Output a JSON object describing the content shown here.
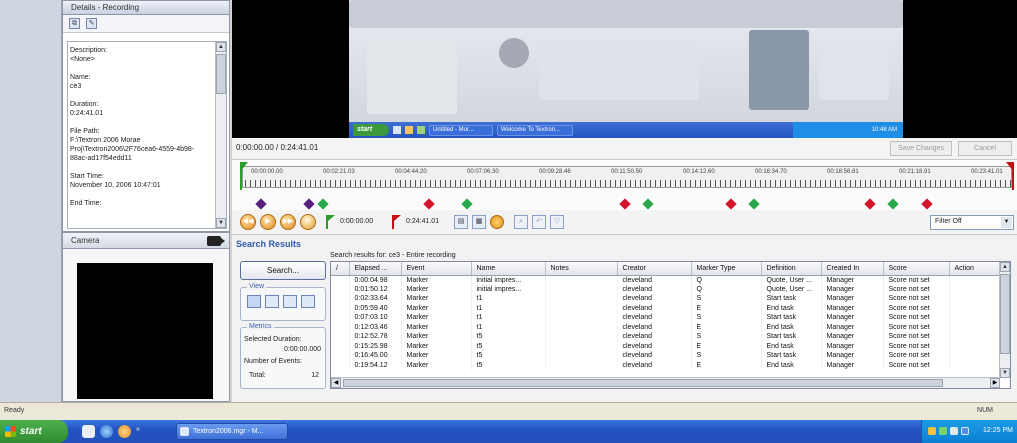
{
  "details": {
    "title": "Details - Recording",
    "content": "Description:\n<None>\n\nName:\nce3\n\nDuration:\n0:24:41.01\n\nFile Path:\nF:\\Textron 2006 Morae Proj\\Textron2006\\2F76cea6-4559-4b98-88ac-ad17f54edd11\n\nStart Time:\nNovember 10, 2006 10:47:01\n\nEnd Time:"
  },
  "camera": {
    "title": "Camera"
  },
  "video": {
    "start_label": "start",
    "taskbar_items": [
      "Untitled - Mor...",
      "Welcome To Textron..."
    ],
    "tray_time": "10:48 AM"
  },
  "timeline": {
    "time_display": "0:00:00.00 / 0:24:41.01",
    "save_changes": "Save Changes",
    "cancel": "Cancel",
    "tick_labels": [
      "00:00:00.00",
      "00:02:21.03",
      "00:04:44.20",
      "00:07:06.30",
      "00:09:28.46",
      "00:11:50.50",
      "00:14:12.60",
      "00:16:34.70",
      "00:18:56.81",
      "00:21:18.91",
      "00:23:41.01"
    ],
    "markers": [
      {
        "color": "#5a2080",
        "pos": 0.025
      },
      {
        "color": "#5a2080",
        "pos": 0.087
      },
      {
        "color": "#2aa84a",
        "pos": 0.105
      },
      {
        "color": "#d3142a",
        "pos": 0.243
      },
      {
        "color": "#2aa84a",
        "pos": 0.292
      },
      {
        "color": "#d3142a",
        "pos": 0.497
      },
      {
        "color": "#2aa84a",
        "pos": 0.527
      },
      {
        "color": "#d3142a",
        "pos": 0.635
      },
      {
        "color": "#2aa84a",
        "pos": 0.665
      },
      {
        "color": "#d3142a",
        "pos": 0.815
      },
      {
        "color": "#2aa84a",
        "pos": 0.845
      },
      {
        "color": "#d3142a",
        "pos": 0.89
      }
    ]
  },
  "controls": {
    "start_time": "0:00:00.00",
    "end_time": "0:24:41.01",
    "filter": "Filter Off"
  },
  "search": {
    "heading": "Search Results",
    "button": "Search...",
    "view_label": "View",
    "metrics_label": "Metrics",
    "selected_duration_label": "Selected Duration:",
    "selected_duration_value": "0:00:00.000",
    "number_of_events_label": "Number of Events:",
    "total_label": "Total:",
    "total_value": "12",
    "results_caption": "Search results for: ce3 - Entire recording",
    "columns": [
      "/",
      "Elapsed ...",
      "Event",
      "Name",
      "Notes",
      "Creator",
      "Marker Type",
      "Definition",
      "Created In",
      "Score",
      "Action"
    ],
    "rows": [
      [
        "",
        "0:00:04.98",
        "Marker",
        "initial impres...",
        "",
        "cleveland",
        "Q",
        "Quote, User ...",
        "Manager",
        "Score not set",
        ""
      ],
      [
        "",
        "0:01:50.12",
        "Marker",
        "initial impres...",
        "",
        "cleveland",
        "Q",
        "Quote, User ...",
        "Manager",
        "Score not set",
        ""
      ],
      [
        "",
        "0:02:33.64",
        "Marker",
        "t1",
        "",
        "cleveland",
        "S",
        "Start task",
        "Manager",
        "Score not set",
        ""
      ],
      [
        "",
        "0:05:59.40",
        "Marker",
        "t1",
        "",
        "cleveland",
        "E",
        "End task",
        "Manager",
        "Score not set",
        ""
      ],
      [
        "",
        "0:07:03.10",
        "Marker",
        "t1",
        "",
        "cleveland",
        "S",
        "Start task",
        "Manager",
        "Score not set",
        ""
      ],
      [
        "",
        "0:12:03.46",
        "Marker",
        "t1",
        "",
        "cleveland",
        "E",
        "End task",
        "Manager",
        "Score not set",
        ""
      ],
      [
        "",
        "0:12:52.78",
        "Marker",
        "t5",
        "",
        "cleveland",
        "S",
        "Start task",
        "Manager",
        "Score not set",
        ""
      ],
      [
        "",
        "0:15:25.98",
        "Marker",
        "t5",
        "",
        "cleveland",
        "E",
        "End task",
        "Manager",
        "Score not set",
        ""
      ],
      [
        "",
        "0:16:45.00",
        "Marker",
        "t5",
        "",
        "cleveland",
        "S",
        "Start task",
        "Manager",
        "Score not set",
        ""
      ],
      [
        "",
        "0:19:54.12",
        "Marker",
        "t5",
        "",
        "cleveland",
        "E",
        "End task",
        "Manager",
        "Score not set",
        ""
      ]
    ]
  },
  "status": {
    "text": "Ready",
    "num": "NUM"
  },
  "taskbar": {
    "start": "start",
    "app": "Textron2006.mgr - M...",
    "clock": "12:25 PM"
  }
}
